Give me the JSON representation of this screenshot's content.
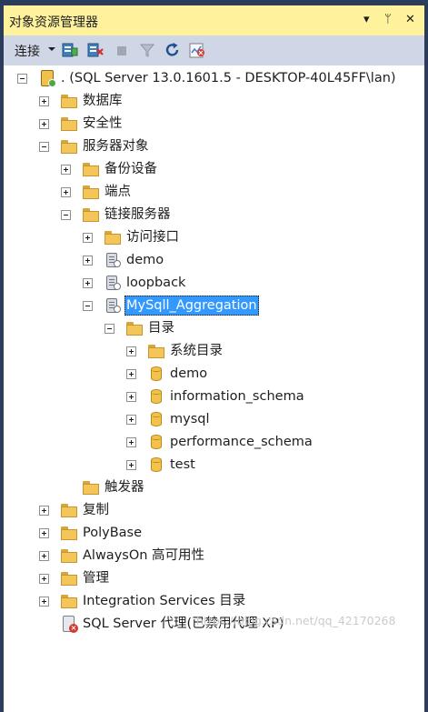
{
  "window": {
    "title": "对象资源管理器"
  },
  "titlebar_buttons": {
    "dropdown": "▾",
    "pin": "ᛘ",
    "close": "✕"
  },
  "toolbar": {
    "connect_label": "连接"
  },
  "tree": [
    {
      "key": "server",
      "label": ". (SQL Server 13.0.1601.5 - DESKTOP-40L45FF\\lan)",
      "icon": "server-icon",
      "expander": "minus",
      "depth": 0
    },
    {
      "key": "databases",
      "label": "数据库",
      "icon": "folder-icon",
      "expander": "plus",
      "depth": 1
    },
    {
      "key": "security",
      "label": "安全性",
      "icon": "folder-icon",
      "expander": "plus",
      "depth": 1
    },
    {
      "key": "server-objects",
      "label": "服务器对象",
      "icon": "folder-icon",
      "expander": "minus",
      "depth": 1
    },
    {
      "key": "backup-devices",
      "label": "备份设备",
      "icon": "folder-icon",
      "expander": "plus",
      "depth": 2
    },
    {
      "key": "endpoints",
      "label": "端点",
      "icon": "folder-icon",
      "expander": "plus",
      "depth": 2
    },
    {
      "key": "linked-servers",
      "label": "链接服务器",
      "icon": "folder-icon",
      "expander": "minus",
      "depth": 2
    },
    {
      "key": "providers",
      "label": "访问接口",
      "icon": "folder-icon",
      "expander": "plus",
      "depth": 3
    },
    {
      "key": "ls-demo",
      "label": "demo",
      "icon": "linked-server-icon",
      "expander": "plus",
      "depth": 3
    },
    {
      "key": "ls-loopback",
      "label": "loopback",
      "icon": "linked-server-icon",
      "expander": "plus",
      "depth": 3
    },
    {
      "key": "ls-mysql",
      "label": "MySqll_Aggregation",
      "icon": "linked-server-icon",
      "expander": "minus",
      "depth": 3,
      "selected": true
    },
    {
      "key": "catalogs",
      "label": "目录",
      "icon": "folder-icon",
      "expander": "minus",
      "depth": 4
    },
    {
      "key": "system-catalogs",
      "label": "系统目录",
      "icon": "folder-icon",
      "expander": "plus",
      "depth": 5
    },
    {
      "key": "cat-demo",
      "label": "demo",
      "icon": "database-icon",
      "expander": "plus",
      "depth": 5
    },
    {
      "key": "cat-information-schema",
      "label": "information_schema",
      "icon": "database-icon",
      "expander": "plus",
      "depth": 5
    },
    {
      "key": "cat-mysql",
      "label": "mysql",
      "icon": "database-icon",
      "expander": "plus",
      "depth": 5
    },
    {
      "key": "cat-performance-schema",
      "label": "performance_schema",
      "icon": "database-icon",
      "expander": "plus",
      "depth": 5
    },
    {
      "key": "cat-test",
      "label": "test",
      "icon": "database-icon",
      "expander": "plus",
      "depth": 5
    },
    {
      "key": "triggers",
      "label": "触发器",
      "icon": "folder-icon",
      "expander": "none",
      "depth": 2
    },
    {
      "key": "replication",
      "label": "复制",
      "icon": "folder-icon",
      "expander": "plus",
      "depth": 1
    },
    {
      "key": "polybase",
      "label": "PolyBase",
      "icon": "folder-icon",
      "expander": "plus",
      "depth": 1
    },
    {
      "key": "alwayson",
      "label": "AlwaysOn 高可用性",
      "icon": "folder-icon",
      "expander": "plus",
      "depth": 1
    },
    {
      "key": "management",
      "label": "管理",
      "icon": "folder-icon",
      "expander": "plus",
      "depth": 1
    },
    {
      "key": "integration-services",
      "label": "Integration Services 目录",
      "icon": "folder-icon",
      "expander": "plus",
      "depth": 1
    },
    {
      "key": "sql-agent",
      "label": "SQL Server 代理(已禁用代理 XP)",
      "icon": "sql-agent-icon",
      "expander": "none",
      "depth": 1
    }
  ],
  "watermark": "https://blog.csdn.net/qq_42170268"
}
